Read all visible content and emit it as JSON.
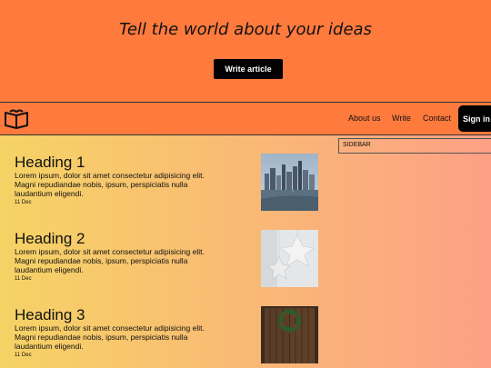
{
  "hero": {
    "title": "Tell the world about your ideas",
    "cta_label": "Write article"
  },
  "nav": {
    "links": [
      "About us",
      "Write",
      "Contact"
    ],
    "signin_label": "Sign in"
  },
  "sidebar": {
    "label": "SIDEBAR"
  },
  "articles": [
    {
      "heading": "Heading 1",
      "excerpt": "Lorem ipsum, dolor sit amet consectetur adipisicing elit. Magni repudiandae nobis, ipsum, perspiciatis nulla laudantium eligendi.",
      "date": "11 Dec"
    },
    {
      "heading": "Heading 2",
      "excerpt": "Lorem ipsum, dolor sit amet consectetur adipisicing elit. Magni repudiandae nobis, ipsum, perspiciatis nulla laudantium eligendi.",
      "date": "11 Dec"
    },
    {
      "heading": "Heading 3",
      "excerpt": "Lorem ipsum, dolor sit amet consectetur adipisicing elit. Magni repudiandae nobis, ipsum, perspiciatis nulla laudantium eligendi.",
      "date": "11 Dec"
    }
  ],
  "colors": {
    "hero_bg": "#ff7a3d",
    "gradient_start": "#f6d365",
    "gradient_end": "#fda085",
    "button_bg": "#000000"
  }
}
